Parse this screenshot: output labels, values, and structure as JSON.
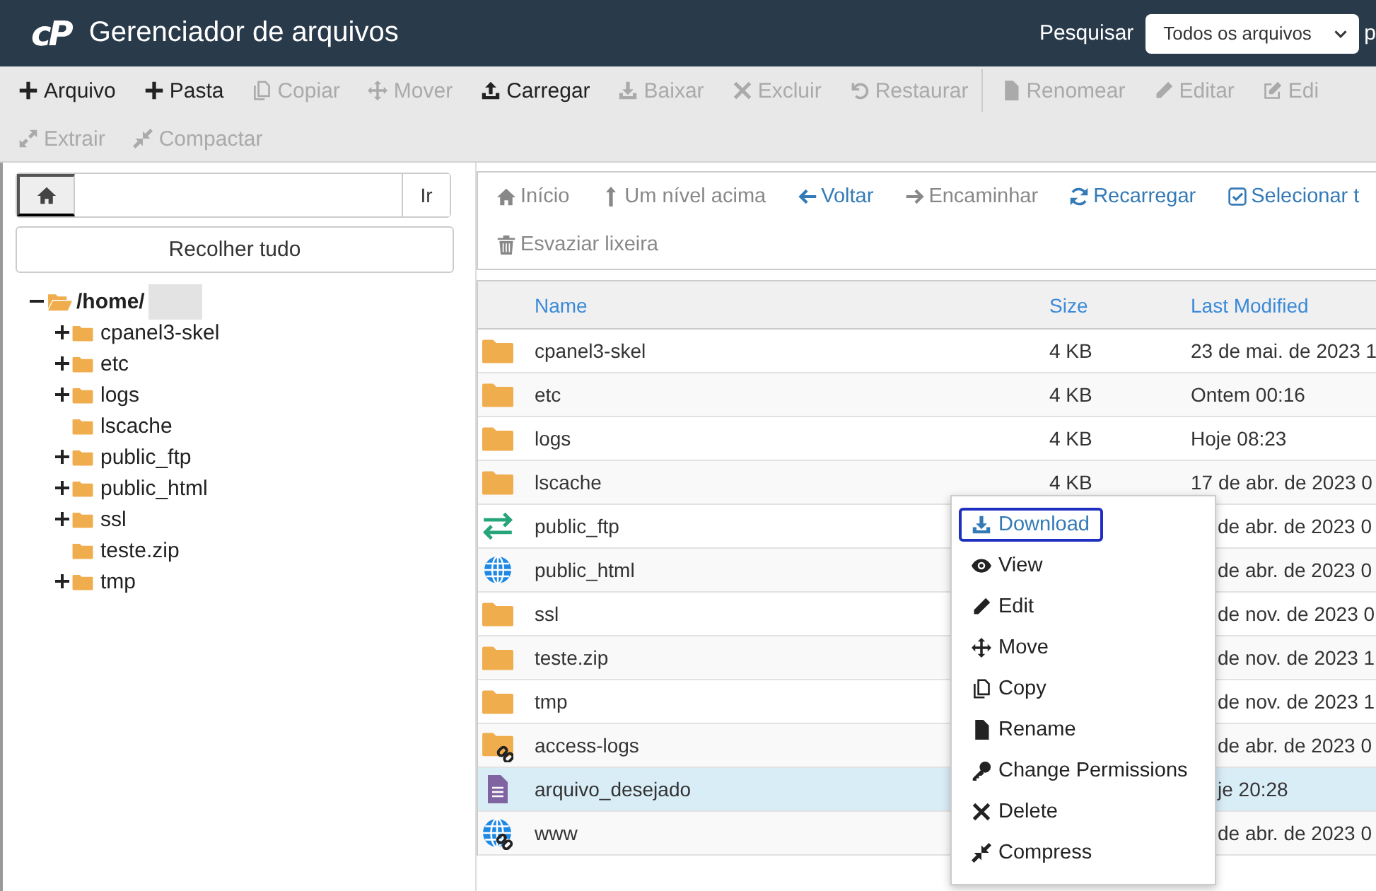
{
  "header": {
    "logo": "cP",
    "title": "Gerenciador de arquivos",
    "search_label": "Pesquisar",
    "search_scope": "Todos os arquivos",
    "cut_text": "p"
  },
  "toolbar_rows": [
    [
      {
        "kind": "plus",
        "label": "Arquivo",
        "disabled": false
      },
      {
        "kind": "plus",
        "label": "Pasta",
        "disabled": false
      },
      {
        "kind": "copy",
        "label": "Copiar",
        "disabled": true
      },
      {
        "kind": "move",
        "label": "Mover",
        "disabled": true
      },
      {
        "kind": "upload",
        "label": "Carregar",
        "disabled": false
      },
      {
        "kind": "download",
        "label": "Baixar",
        "disabled": true
      },
      {
        "kind": "delete",
        "label": "Excluir",
        "disabled": true
      },
      {
        "kind": "restore",
        "label": "Restaurar",
        "disabled": true
      },
      {
        "kind": "file",
        "label": "Renomear",
        "disabled": true,
        "separator_before": true
      },
      {
        "kind": "pencil",
        "label": "Editar",
        "disabled": true
      },
      {
        "kind": "edit",
        "label": "Edi",
        "disabled": true
      }
    ],
    [
      {
        "kind": "extract",
        "label": "Extrair",
        "disabled": true
      },
      {
        "kind": "compress",
        "label": "Compactar",
        "disabled": true
      }
    ]
  ],
  "path_bar": {
    "go_label": "Ir"
  },
  "collapse_label": "Recolher tudo",
  "tree": {
    "label": "/home/",
    "expanded": true,
    "redacted": true,
    "children": [
      {
        "label": "cpanel3-skel",
        "expandable": true
      },
      {
        "label": "etc",
        "expandable": true
      },
      {
        "label": "logs",
        "expandable": true
      },
      {
        "label": "lscache",
        "expandable": false
      },
      {
        "label": "public_ftp",
        "expandable": true
      },
      {
        "label": "public_html",
        "expandable": true
      },
      {
        "label": "ssl",
        "expandable": true
      },
      {
        "label": "teste.zip",
        "expandable": false
      },
      {
        "label": "tmp",
        "expandable": true
      }
    ]
  },
  "nav_rows": [
    [
      {
        "kind": "home",
        "label": "Início",
        "disabled": true
      },
      {
        "kind": "up",
        "label": "Um nível acima",
        "disabled": true
      },
      {
        "kind": "back",
        "label": "Voltar",
        "disabled": false
      },
      {
        "kind": "forward",
        "label": "Encaminhar",
        "disabled": true
      },
      {
        "kind": "reload",
        "label": "Recarregar",
        "disabled": false
      },
      {
        "kind": "select",
        "label": "Selecionar t",
        "disabled": false
      }
    ],
    [
      {
        "kind": "trash",
        "label": "Esvaziar lixeira",
        "disabled": true
      }
    ]
  ],
  "table": {
    "columns": [
      "Name",
      "Size",
      "Last Modified"
    ],
    "rows": [
      {
        "kind": "folder",
        "name": "cpanel3-skel",
        "size": "4 KB",
        "modified": "23 de mai. de 2023 1",
        "selected": false
      },
      {
        "kind": "folder",
        "name": "etc",
        "size": "4 KB",
        "modified": "Ontem 00:16",
        "selected": false
      },
      {
        "kind": "folder",
        "name": "logs",
        "size": "4 KB",
        "modified": "Hoje 08:23",
        "selected": false
      },
      {
        "kind": "folder",
        "name": "lscache",
        "size": "4 KB",
        "modified": "17 de abr. de 2023 0",
        "selected": false
      },
      {
        "kind": "transfer",
        "name": "public_ftp",
        "modified": "de abr. de 2023 0",
        "selected": false
      },
      {
        "kind": "web",
        "name": "public_html",
        "modified": "de abr. de 2023 0",
        "selected": false
      },
      {
        "kind": "folder",
        "name": "ssl",
        "modified": "de nov. de 2023 0",
        "selected": false
      },
      {
        "kind": "folder",
        "name": "teste.zip",
        "modified": "de nov. de 2023 1",
        "selected": false
      },
      {
        "kind": "folder",
        "name": "tmp",
        "modified": "de nov. de 2023 1",
        "selected": false
      },
      {
        "kind": "folder-link",
        "name": "access-logs",
        "modified": "de abr. de 2023 0",
        "selected": false
      },
      {
        "kind": "text-file",
        "name": "arquivo_desejado",
        "modified": "je 20:28",
        "selected": true
      },
      {
        "kind": "web-link",
        "name": "www",
        "modified": "de abr. de 2023 0",
        "selected": false
      }
    ]
  },
  "context_menu": [
    {
      "kind": "download",
      "label": "Download",
      "selected": true
    },
    {
      "kind": "view",
      "label": "View",
      "selected": false
    },
    {
      "kind": "pencil",
      "label": "Edit",
      "selected": false
    },
    {
      "kind": "move",
      "label": "Move",
      "selected": false
    },
    {
      "kind": "copy",
      "label": "Copy",
      "selected": false
    },
    {
      "kind": "file",
      "label": "Rename",
      "selected": false
    },
    {
      "kind": "key",
      "label": "Change Permissions",
      "selected": false
    },
    {
      "kind": "delete",
      "label": "Delete",
      "selected": false
    },
    {
      "kind": "compress",
      "label": "Compress",
      "selected": false
    }
  ]
}
